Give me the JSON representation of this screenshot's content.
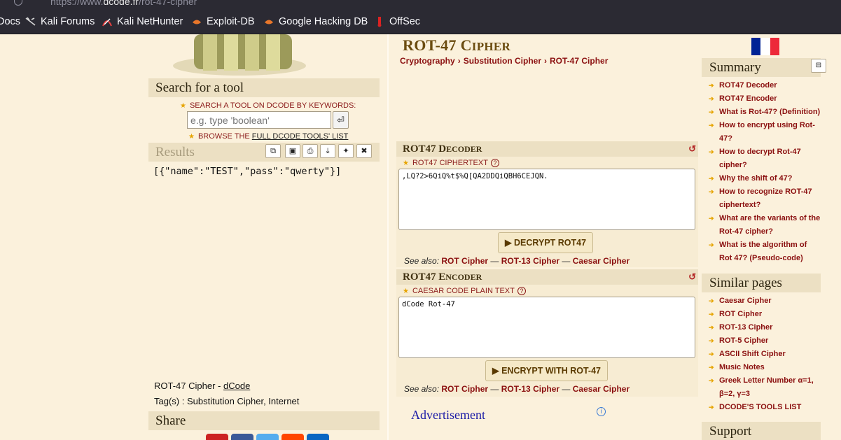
{
  "browser": {
    "url_prefix": "https://www.",
    "url_domain": "dcode.fr",
    "url_path": "/rot-47-cipher",
    "bookmarks": [
      "Docs",
      "Kali Forums",
      "Kali NetHunter",
      "Exploit-DB",
      "Google Hacking DB",
      "OffSec"
    ]
  },
  "left": {
    "search_title": "Search for a tool",
    "search_hint": "SEARCH A TOOL ON DCODE BY KEYWORDS:",
    "search_placeholder": "e.g. type 'boolean'",
    "search_btn": "⏎",
    "browse_prefix": "BROWSE THE ",
    "browse_link": "FULL DCODE TOOLS' LIST",
    "results_title": "Results",
    "results_text": "[{\"name\":\"TEST\",\"pass\":\"qwerty\"}]",
    "credit_prefix": "ROT-47 Cipher - ",
    "credit_link": "dCode",
    "tags": "Tag(s) : Substitution Cipher, Internet",
    "share_title": "Share"
  },
  "main": {
    "title_first": "ROT-47 C",
    "title_sc": "IPHER",
    "breadcrumbs": [
      "Cryptography",
      "Substitution Cipher",
      "ROT-47 Cipher"
    ],
    "decoder": {
      "title_first": "ROT47 D",
      "title_sc": "ECODER",
      "field_label": "ROT47 CIPHERTEXT",
      "value": ",LQ?2>6QiQ%t$%Q[QA2DDQiQBH6CEJQN.",
      "button": "▶ DECRYPT ROT47"
    },
    "encoder": {
      "title_first": "ROT47 E",
      "title_sc": "NCODER",
      "field_label": "CAESAR CODE PLAIN TEXT",
      "value": "dCode Rot-47",
      "button": "▶ ENCRYPT WITH ROT-47"
    },
    "see_also_label": "See also: ",
    "see_also": [
      "ROT Cipher",
      "ROT-13 Cipher",
      "Caesar Cipher"
    ],
    "see_also_sep": " — ",
    "advert": "Advertisement"
  },
  "right": {
    "summary_title": "Summary",
    "summary_items": [
      "ROT47 Decoder",
      "ROT47 Encoder",
      "What is Rot-47? (Definition)",
      "How to encrypt using Rot-47?",
      "How to decrypt Rot-47 cipher?",
      "Why the shift of 47?",
      "How to recognize ROT-47 ciphertext?",
      "What are the variants of the Rot-47 cipher?",
      "What is the algorithm of Rot 47? (Pseudo-code)"
    ],
    "similar_title": "Similar pages",
    "similar_items": [
      "Caesar Cipher",
      "ROT Cipher",
      "ROT-13 Cipher",
      "ROT-5 Cipher",
      "ASCII Shift Cipher",
      "Music Notes",
      "Greek Letter Number α=1, β=2, γ=3",
      "DCODE'S TOOLS LIST"
    ],
    "support_title": "Support"
  },
  "colors": {
    "page_bg": "#fbf1dc",
    "section_head_bg": "#ece0c3",
    "link_red": "#8b1010",
    "title_brown": "#6b4c10",
    "browser_bar": "#2b2a33",
    "flag": [
      "#002395",
      "#ffffff",
      "#ed2939"
    ]
  }
}
